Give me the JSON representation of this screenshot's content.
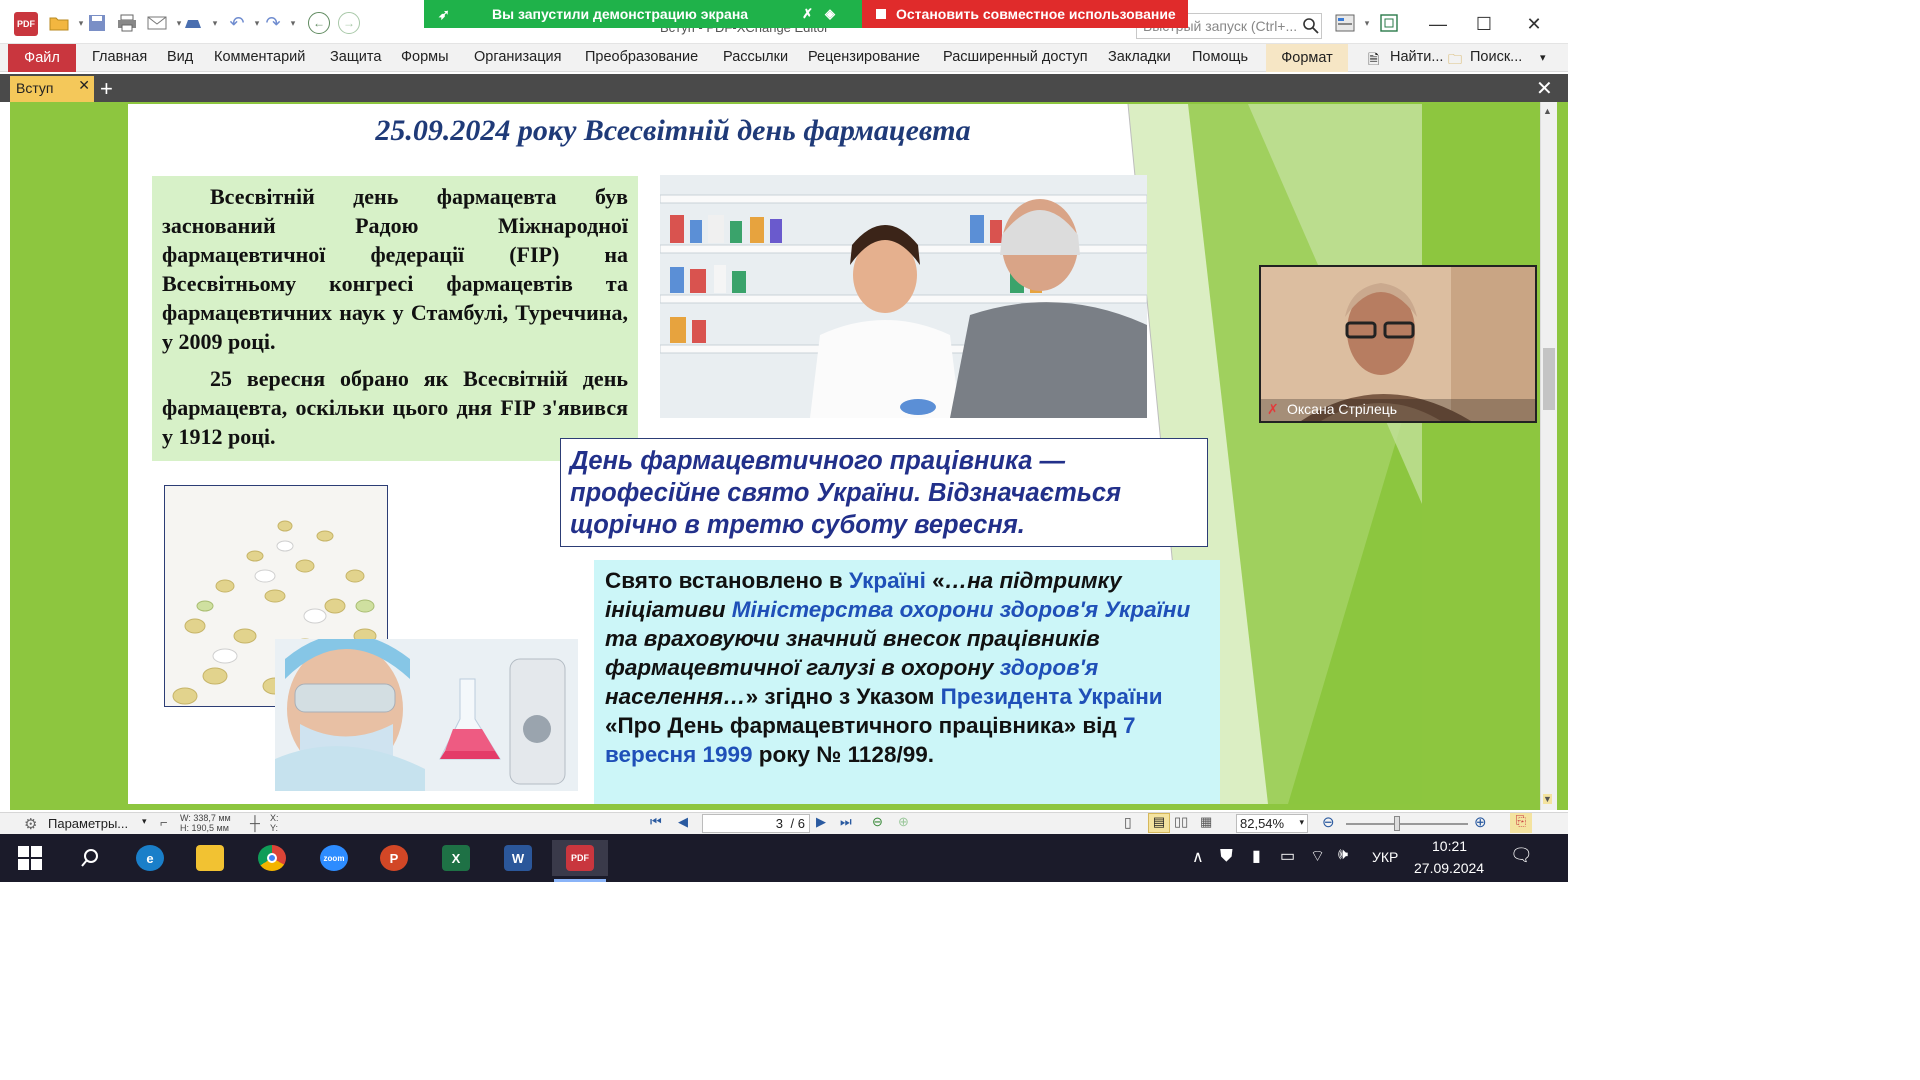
{
  "window": {
    "title": "Вступ - PDF-XChange Editor",
    "quick_search_placeholder": "Быстрый запуск (Ctrl+..."
  },
  "screen_share": {
    "status": "Вы запустили демонстрацию экрана",
    "stop_label": "Остановить совместное использование"
  },
  "menu": {
    "file": "Файл",
    "items": [
      "Главная",
      "Вид",
      "Комментарий",
      "Защита",
      "Формы",
      "Организация",
      "Преобразование",
      "Рассылки",
      "Рецензирование",
      "Расширенный доступ",
      "Закладки",
      "Помощь"
    ],
    "format": "Формат",
    "find": "Найти...",
    "search": "Поиск..."
  },
  "tab": {
    "label": "Вступ"
  },
  "slide": {
    "title": "25.09.2024 року Всесвітній день фармацевта",
    "para1": "Всесвітній день фармацевта був заснований Радою Міжнародної фармацевтичної федерації (FIP) на Всесвітньому конгресі фармацевтів та фармацевтичних наук у Стамбулі, Туреччина, у 2009 році.",
    "para2": "25 вересня обрано як Всесвітній день фармацевта, оскільки цього дня FIP з'явився у 1912 році.",
    "holiday": "День фармацевтичного працівника — професійне свято України. Відзначається щорічно в третю суботу вересня.",
    "decree": {
      "t1": "Свято встановлено в ",
      "l1": "Україні",
      "t2": " «",
      "i1": "…на підтримку ініціативи ",
      "l2": "Міністерства охорони здоров'я України",
      "i2": " та враховуючи значний внесок працівників фармацевтичної галузі в охорону ",
      "l3": "здоров'я",
      "i3": " населення…",
      "t3": "» згідно з Указом ",
      "l4": "Президента України",
      "t4": " «Про День фармацевтичного працівника» від ",
      "l5": "7 вересня 1999",
      "t5": " року № 1128/99."
    }
  },
  "webcam": {
    "name": "Оксана Стрілець"
  },
  "statusbar": {
    "params": "Параметры...",
    "width": "W: 338,7 мм",
    "height": "H: 190,5 мм",
    "x": "X:",
    "y": "Y:",
    "page": "3",
    "page_total": "/ 6",
    "zoom": "82,54%"
  },
  "taskbar": {
    "apps": [
      "edge",
      "explorer",
      "chrome",
      "zoom",
      "powerpoint",
      "excel",
      "word",
      "pdf-xchange"
    ],
    "lang": "УКР",
    "time": "10:21",
    "date": "27.09.2024"
  },
  "colors": {
    "share_green": "#1fb24a",
    "share_red": "#e02b2b",
    "file_menu": "#c9363e",
    "tab_active": "#f4c85a",
    "doc_bg": "#8dc63f",
    "title_blue": "#1f3a78",
    "link_blue": "#1f50b8"
  }
}
